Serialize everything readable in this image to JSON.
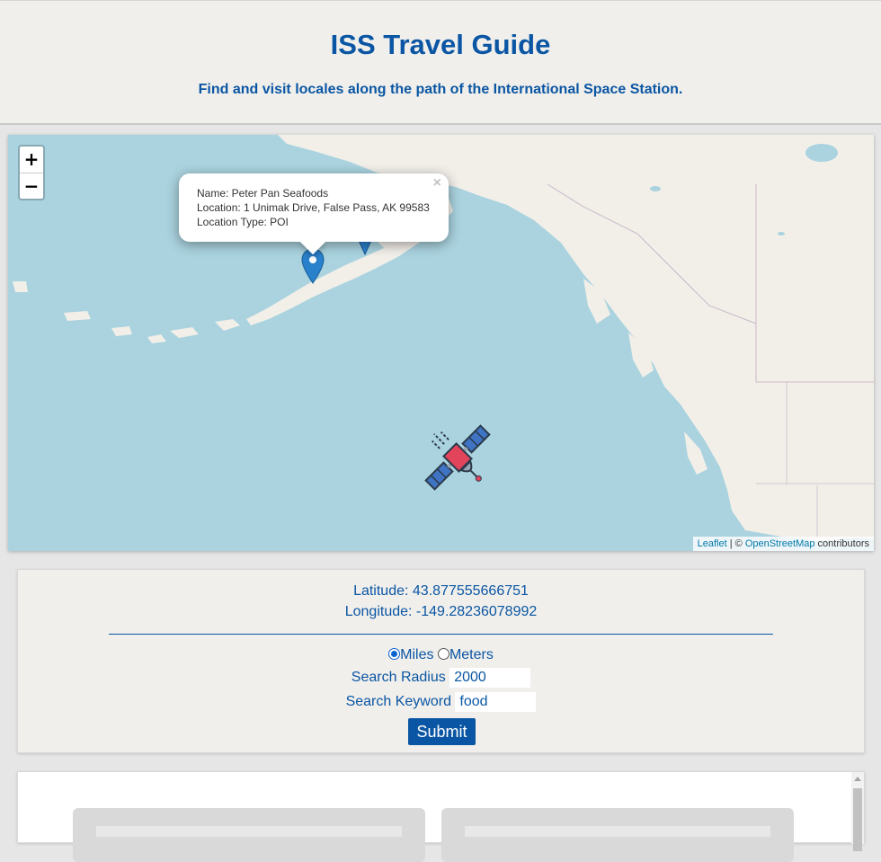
{
  "header": {
    "title": "ISS Travel Guide",
    "subtitle": "Find and visit locales along the path of the International Space Station."
  },
  "map": {
    "zoom_in": "+",
    "zoom_out": "−",
    "popup": {
      "close": "×",
      "name_line": "Name: Peter Pan Seafoods",
      "location_line": "Location: 1 Unimak Drive, False Pass, AK 99583",
      "type_line": "Location Type: POI"
    },
    "attribution": {
      "leaflet": "Leaflet",
      "sep": " | © ",
      "osm": "OpenStreetMap",
      "suffix": " contributors"
    },
    "icons": {
      "marker": "map-marker-icon",
      "satellite": "satellite-icon"
    }
  },
  "panel": {
    "latitude": "Latitude: 43.877555666751",
    "longitude": "Longitude: -149.28236078992",
    "unit_miles": "Miles",
    "unit_meters": "Meters",
    "radius_label": "Search Radius",
    "radius_value": "2000",
    "keyword_label": "Search Keyword",
    "keyword_value": "food",
    "submit": "Submit"
  },
  "colors": {
    "accent": "#0b56a4",
    "water": "#aad3df",
    "land": "#f2efe9"
  }
}
